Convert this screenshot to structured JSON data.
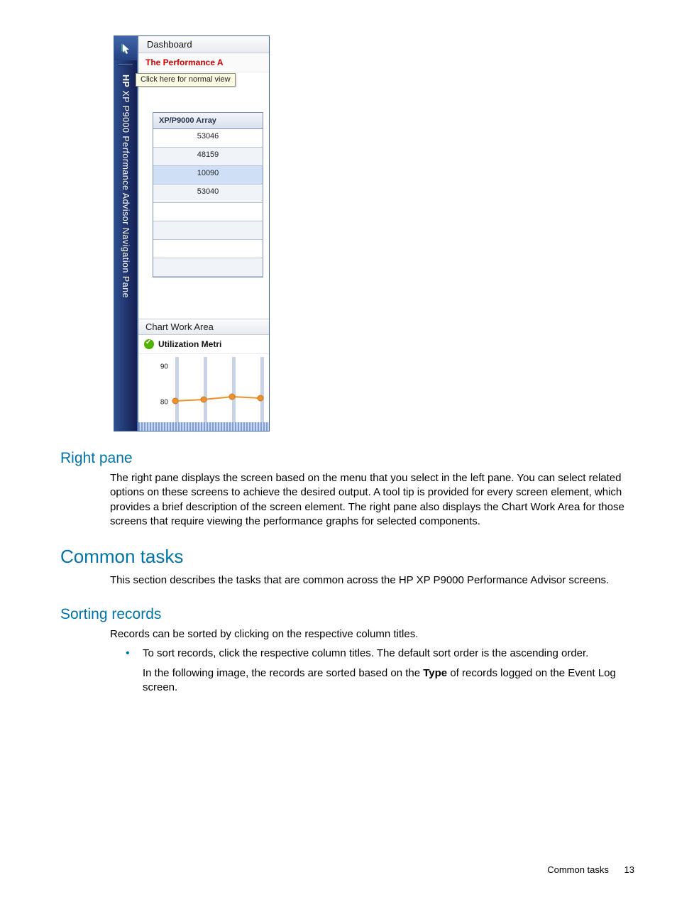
{
  "screenshot": {
    "rail_label_bold": "HP",
    "rail_label_rest": "XP P9000 Performance Advisor Navigation Pane",
    "dashboard_title": "Dashboard",
    "sub_header": "The Performance A",
    "tooltip": "Click here for normal view",
    "grid_header": "XP/P9000 Array",
    "grid_rows": [
      "53046",
      "48159",
      "10090",
      "53040",
      "",
      "",
      "",
      ""
    ],
    "cwa_title": "Chart Work Area",
    "metric_label": "Utilization Metri"
  },
  "chart_data": {
    "type": "line",
    "ylim": [
      80,
      90
    ],
    "y_ticks": [
      90,
      80
    ],
    "y_values": [
      80.5,
      80.8,
      81.5,
      81.2
    ],
    "xlabel": "",
    "ylabel": "",
    "title": ""
  },
  "doc": {
    "h_right_pane": "Right pane",
    "p_right_pane": "The right pane displays the screen based on the menu that you select in the left pane. You can select related options on these screens to achieve the desired output. A tool tip is provided for every screen element, which provides a brief description of the screen element. The right pane also displays the Chart Work Area for those screens that require viewing the performance graphs for selected components.",
    "h_common": "Common tasks",
    "p_common": "This section describes the tasks that are common across the HP XP P9000 Performance Advisor screens.",
    "h_sort": "Sorting records",
    "p_sort": "Records can be sorted by clicking on the respective column titles.",
    "bullet_1a": "To sort records, click the respective column titles. The default sort order is the ascending order.",
    "bullet_1b_pre": "In the following image, the records are sorted based on the ",
    "bullet_1b_bold": "Type",
    "bullet_1b_post": " of records logged on the Event Log screen."
  },
  "footer": {
    "section": "Common tasks",
    "page": "13"
  }
}
